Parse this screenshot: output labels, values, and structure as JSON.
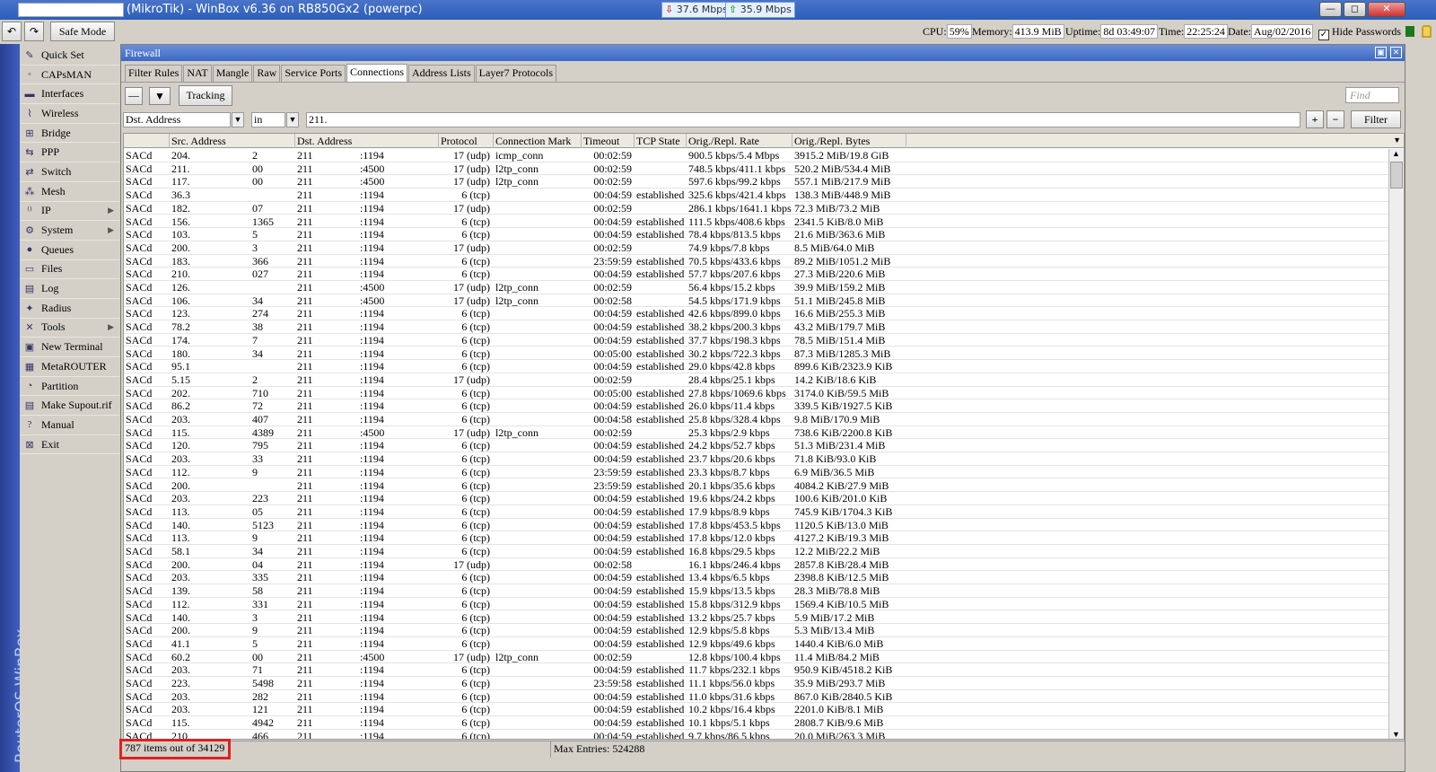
{
  "titlebar": {
    "title": "(MikroTik) - WinBox v6.36 on RB850Gx2 (powerpc)",
    "tx": "37.6 Mbps",
    "rx": "35.9 Mbps",
    "minimize": "—",
    "maximize": "◻",
    "close": "✕"
  },
  "toolbar": {
    "undo": "↶",
    "redo": "↷",
    "safe_mode": "Safe Mode",
    "cpu_label": "CPU:",
    "cpu": "59%",
    "memory_label": "Memory:",
    "memory": "413.9 MiB",
    "uptime_label": "Uptime:",
    "uptime": "8d 03:49:07",
    "time_label": "Time:",
    "time": "22:25:24",
    "date_label": "Date:",
    "date": "Aug/02/2016",
    "hide_passwords": "Hide Passwords",
    "hide_passwords_check": "✓"
  },
  "sidebar": {
    "brand": "RouterOS WinBox",
    "items": [
      {
        "label": "Quick Set",
        "icon": "✎"
      },
      {
        "label": "CAPsMAN",
        "icon": "◦"
      },
      {
        "label": "Interfaces",
        "icon": "▬"
      },
      {
        "label": "Wireless",
        "icon": "⌇"
      },
      {
        "label": "Bridge",
        "icon": "⊞"
      },
      {
        "label": "PPP",
        "icon": "⇆"
      },
      {
        "label": "Switch",
        "icon": "⇄"
      },
      {
        "label": "Mesh",
        "icon": "⁂"
      },
      {
        "label": "IP",
        "icon": "⁽⁾",
        "sub": "▶"
      },
      {
        "label": "System",
        "icon": "⚙",
        "sub": "▶"
      },
      {
        "label": "Queues",
        "icon": "●"
      },
      {
        "label": "Files",
        "icon": "▭"
      },
      {
        "label": "Log",
        "icon": "▤"
      },
      {
        "label": "Radius",
        "icon": "✦"
      },
      {
        "label": "Tools",
        "icon": "✕",
        "sub": "▶"
      },
      {
        "label": "New Terminal",
        "icon": "▣"
      },
      {
        "label": "MetaROUTER",
        "icon": "▦"
      },
      {
        "label": "Partition",
        "icon": "◔"
      },
      {
        "label": "Make Supout.rif",
        "icon": "▤"
      },
      {
        "label": "Manual",
        "icon": "?"
      },
      {
        "label": "Exit",
        "icon": "⊠"
      }
    ]
  },
  "firewall": {
    "title": "Firewall",
    "restore": "▣",
    "close": "✕",
    "tabs": [
      "Filter Rules",
      "NAT",
      "Mangle",
      "Raw",
      "Service Ports",
      "Connections",
      "Address Lists",
      "Layer7 Protocols"
    ],
    "active_tab": 5,
    "minus_btn": "—",
    "filter_icon": "▼",
    "tracking": "Tracking",
    "find_placeholder": "Find",
    "filter_field": "Dst. Address",
    "filter_op": "in",
    "filter_value": "211.",
    "plus": "+",
    "minus": "−",
    "filter_btn": "Filter",
    "columns": [
      "",
      "Src. Address",
      "Dst. Address",
      "Protocol",
      "Connection Mark",
      "Timeout",
      "TCP State",
      "Orig./Repl. Rate",
      "Orig./Repl. Bytes"
    ],
    "rows": [
      [
        "SACd",
        "204.",
        "2",
        "211",
        ":1194",
        "17 (udp)",
        "icmp_conn",
        "00:02:59",
        "",
        "900.5 kbps/5.4 Mbps",
        "3915.2 MiB/19.8 GiB"
      ],
      [
        "SACd",
        "211.",
        "00",
        "211",
        ":4500",
        "17 (udp)",
        "l2tp_conn",
        "00:02:59",
        "",
        "748.5 kbps/411.1 kbps",
        "520.2 MiB/534.4 MiB"
      ],
      [
        "SACd",
        "117.",
        "00",
        "211",
        ":4500",
        "17 (udp)",
        "l2tp_conn",
        "00:02:59",
        "",
        "597.6 kbps/99.2 kbps",
        "557.1 MiB/217.9 MiB"
      ],
      [
        "SACd",
        "36.3",
        "",
        "211",
        ":1194",
        "6 (tcp)",
        "",
        "00:04:59",
        "established",
        "325.6 kbps/421.4 kbps",
        "138.3 MiB/448.9 MiB"
      ],
      [
        "SACd",
        "182.",
        "07",
        "211",
        ":1194",
        "17 (udp)",
        "",
        "00:02:59",
        "",
        "286.1 kbps/1641.1 kbps",
        "72.3 MiB/73.2 MiB"
      ],
      [
        "SACd",
        "156.",
        "1365",
        "211",
        ":1194",
        "6 (tcp)",
        "",
        "00:04:59",
        "established",
        "111.5 kbps/408.6 kbps",
        "2341.5 KiB/8.0 MiB"
      ],
      [
        "SACd",
        "103.",
        "5",
        "211",
        ":1194",
        "6 (tcp)",
        "",
        "00:04:59",
        "established",
        "78.4 kbps/813.5 kbps",
        "21.6 MiB/363.6 MiB"
      ],
      [
        "SACd",
        "200.",
        "3",
        "211",
        ":1194",
        "17 (udp)",
        "",
        "00:02:59",
        "",
        "74.9 kbps/7.8 kbps",
        "8.5 MiB/64.0 MiB"
      ],
      [
        "SACd",
        "183.",
        "366",
        "211",
        ":1194",
        "6 (tcp)",
        "",
        "23:59:59",
        "established",
        "70.5 kbps/433.6 kbps",
        "89.2 MiB/1051.2 MiB"
      ],
      [
        "SACd",
        "210.",
        "027",
        "211",
        ":1194",
        "6 (tcp)",
        "",
        "00:04:59",
        "established",
        "57.7 kbps/207.6 kbps",
        "27.3 MiB/220.6 MiB"
      ],
      [
        "SACd",
        "126.",
        "",
        "211",
        ":4500",
        "17 (udp)",
        "l2tp_conn",
        "00:02:59",
        "",
        "56.4 kbps/15.2 kbps",
        "39.9 MiB/159.2 MiB"
      ],
      [
        "SACd",
        "106.",
        "34",
        "211",
        ":4500",
        "17 (udp)",
        "l2tp_conn",
        "00:02:58",
        "",
        "54.5 kbps/171.9 kbps",
        "51.1 MiB/245.8 MiB"
      ],
      [
        "SACd",
        "123.",
        "274",
        "211",
        ":1194",
        "6 (tcp)",
        "",
        "00:04:59",
        "established",
        "42.6 kbps/899.0 kbps",
        "16.6 MiB/255.3 MiB"
      ],
      [
        "SACd",
        "78.2",
        "38",
        "211",
        ":1194",
        "6 (tcp)",
        "",
        "00:04:59",
        "established",
        "38.2 kbps/200.3 kbps",
        "43.2 MiB/179.7 MiB"
      ],
      [
        "SACd",
        "174.",
        "7",
        "211",
        ":1194",
        "6 (tcp)",
        "",
        "00:04:59",
        "established",
        "37.7 kbps/198.3 kbps",
        "78.5 MiB/151.4 MiB"
      ],
      [
        "SACd",
        "180.",
        "34",
        "211",
        ":1194",
        "6 (tcp)",
        "",
        "00:05:00",
        "established",
        "30.2 kbps/722.3 kbps",
        "87.3 MiB/1285.3 MiB"
      ],
      [
        "SACd",
        "95.1",
        "",
        "211",
        ":1194",
        "6 (tcp)",
        "",
        "00:04:59",
        "established",
        "29.0 kbps/42.8 kbps",
        "899.6 KiB/2323.9 KiB"
      ],
      [
        "SACd",
        "5.15",
        "2",
        "211",
        ":1194",
        "17 (udp)",
        "",
        "00:02:59",
        "",
        "28.4 kbps/25.1 kbps",
        "14.2 KiB/18.6 KiB"
      ],
      [
        "SACd",
        "202.",
        "710",
        "211",
        ":1194",
        "6 (tcp)",
        "",
        "00:05:00",
        "established",
        "27.8 kbps/1069.6 kbps",
        "3174.0 KiB/59.5 MiB"
      ],
      [
        "SACd",
        "86.2",
        "72",
        "211",
        ":1194",
        "6 (tcp)",
        "",
        "00:04:59",
        "established",
        "26.0 kbps/11.4 kbps",
        "339.5 KiB/1927.5 KiB"
      ],
      [
        "SACd",
        "203.",
        "407",
        "211",
        ":1194",
        "6 (tcp)",
        "",
        "00:04:58",
        "established",
        "25.8 kbps/328.4 kbps",
        "9.8 MiB/170.9 MiB"
      ],
      [
        "SACd",
        "115.",
        "4389",
        "211",
        ":4500",
        "17 (udp)",
        "l2tp_conn",
        "00:02:59",
        "",
        "25.3 kbps/2.9 kbps",
        "738.6 KiB/2200.8 KiB"
      ],
      [
        "SACd",
        "120.",
        "795",
        "211",
        ":1194",
        "6 (tcp)",
        "",
        "00:04:59",
        "established",
        "24.2 kbps/52.7 kbps",
        "51.3 MiB/231.4 MiB"
      ],
      [
        "SACd",
        "203.",
        "33",
        "211",
        ":1194",
        "6 (tcp)",
        "",
        "00:04:59",
        "established",
        "23.7 kbps/20.6 kbps",
        "71.8 KiB/93.0 KiB"
      ],
      [
        "SACd",
        "112.",
        "9",
        "211",
        ":1194",
        "6 (tcp)",
        "",
        "23:59:59",
        "established",
        "23.3 kbps/8.7 kbps",
        "6.9 MiB/36.5 MiB"
      ],
      [
        "SACd",
        "200.",
        "",
        "211",
        ":1194",
        "6 (tcp)",
        "",
        "23:59:59",
        "established",
        "20.1 kbps/35.6 kbps",
        "4084.2 KiB/27.9 MiB"
      ],
      [
        "SACd",
        "203.",
        "223",
        "211",
        ":1194",
        "6 (tcp)",
        "",
        "00:04:59",
        "established",
        "19.6 kbps/24.2 kbps",
        "100.6 KiB/201.0 KiB"
      ],
      [
        "SACd",
        "113.",
        "05",
        "211",
        ":1194",
        "6 (tcp)",
        "",
        "00:04:59",
        "established",
        "17.9 kbps/8.9 kbps",
        "745.9 KiB/1704.3 KiB"
      ],
      [
        "SACd",
        "140.",
        "5123",
        "211",
        ":1194",
        "6 (tcp)",
        "",
        "00:04:59",
        "established",
        "17.8 kbps/453.5 kbps",
        "1120.5 KiB/13.0 MiB"
      ],
      [
        "SACd",
        "113.",
        "9",
        "211",
        ":1194",
        "6 (tcp)",
        "",
        "00:04:59",
        "established",
        "17.8 kbps/12.0 kbps",
        "4127.2 KiB/19.3 MiB"
      ],
      [
        "SACd",
        "58.1",
        "34",
        "211",
        ":1194",
        "6 (tcp)",
        "",
        "00:04:59",
        "established",
        "16.8 kbps/29.5 kbps",
        "12.2 MiB/22.2 MiB"
      ],
      [
        "SACd",
        "200.",
        "04",
        "211",
        ":1194",
        "17 (udp)",
        "",
        "00:02:58",
        "",
        "16.1 kbps/246.4 kbps",
        "2857.8 KiB/28.4 MiB"
      ],
      [
        "SACd",
        "203.",
        "335",
        "211",
        ":1194",
        "6 (tcp)",
        "",
        "00:04:59",
        "established",
        "13.4 kbps/6.5 kbps",
        "2398.8 KiB/12.5 MiB"
      ],
      [
        "SACd",
        "139.",
        "58",
        "211",
        ":1194",
        "6 (tcp)",
        "",
        "00:04:59",
        "established",
        "15.9 kbps/13.5 kbps",
        "28.3 MiB/78.8 MiB"
      ],
      [
        "SACd",
        "112.",
        "331",
        "211",
        ":1194",
        "6 (tcp)",
        "",
        "00:04:59",
        "established",
        "15.8 kbps/312.9 kbps",
        "1569.4 KiB/10.5 MiB"
      ],
      [
        "SACd",
        "140.",
        "3",
        "211",
        ":1194",
        "6 (tcp)",
        "",
        "00:04:59",
        "established",
        "13.2 kbps/25.7 kbps",
        "5.9 MiB/17.2 MiB"
      ],
      [
        "SACd",
        "200.",
        "9",
        "211",
        ":1194",
        "6 (tcp)",
        "",
        "00:04:59",
        "established",
        "12.9 kbps/5.8 kbps",
        "5.3 MiB/13.4 MiB"
      ],
      [
        "SACd",
        "41.1",
        "5",
        "211",
        ":1194",
        "6 (tcp)",
        "",
        "00:04:59",
        "established",
        "12.9 kbps/49.6 kbps",
        "1440.4 KiB/6.0 MiB"
      ],
      [
        "SACd",
        "60.2",
        "00",
        "211",
        ":4500",
        "17 (udp)",
        "l2tp_conn",
        "00:02:59",
        "",
        "12.8 kbps/100.4 kbps",
        "11.4 MiB/84.2 MiB"
      ],
      [
        "SACd",
        "203.",
        "71",
        "211",
        ":1194",
        "6 (tcp)",
        "",
        "00:04:59",
        "established",
        "11.7 kbps/232.1 kbps",
        "950.9 KiB/4518.2 KiB"
      ],
      [
        "SACd",
        "223.",
        "5498",
        "211",
        ":1194",
        "6 (tcp)",
        "",
        "23:59:58",
        "established",
        "11.1 kbps/56.0 kbps",
        "35.9 MiB/293.7 MiB"
      ],
      [
        "SACd",
        "203.",
        "282",
        "211",
        ":1194",
        "6 (tcp)",
        "",
        "00:04:59",
        "established",
        "11.0 kbps/31.6 kbps",
        "867.0 KiB/2840.5 KiB"
      ],
      [
        "SACd",
        "203.",
        "121",
        "211",
        ":1194",
        "6 (tcp)",
        "",
        "00:04:59",
        "established",
        "10.2 kbps/16.4 kbps",
        "2201.0 KiB/8.1 MiB"
      ],
      [
        "SACd",
        "115.",
        "4942",
        "211",
        ":1194",
        "6 (tcp)",
        "",
        "00:04:59",
        "established",
        "10.1 kbps/5.1 kbps",
        "2808.7 KiB/9.6 MiB"
      ],
      [
        "SACd",
        "210.",
        "466",
        "211",
        ":1194",
        "6 (tcp)",
        "",
        "00:04:59",
        "established",
        "9.7 kbps/86.5 kbps",
        "20.0 MiB/263.3 MiB"
      ]
    ],
    "status_count": "787 items out of 34129",
    "status_max": "Max Entries: 524288"
  }
}
